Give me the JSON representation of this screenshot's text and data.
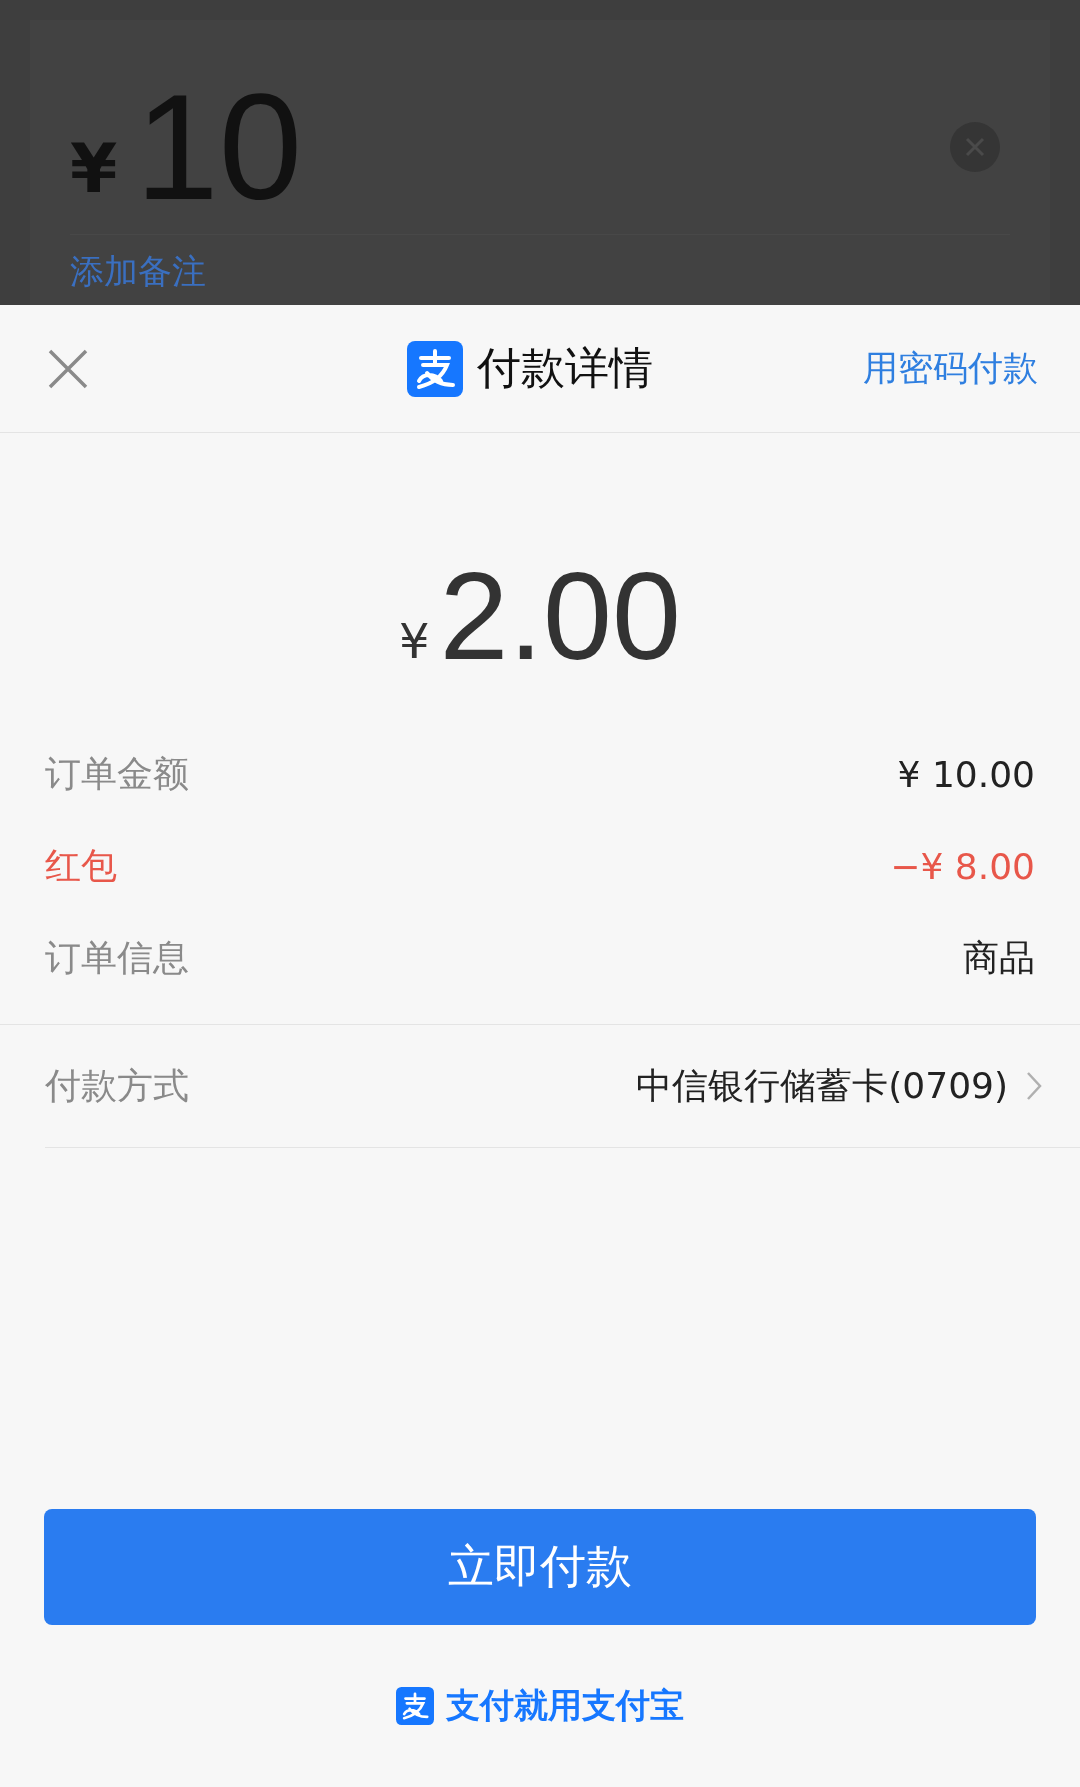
{
  "background_page": {
    "currency": "¥",
    "amount": "10",
    "note_link": "添加备注"
  },
  "sheet": {
    "title": "付款详情",
    "password_link": "用密码付款",
    "amount": {
      "currency": "¥",
      "value": "2.00"
    },
    "details": [
      {
        "label": "订单金额",
        "value": "¥ 10.00",
        "kind": "normal"
      },
      {
        "label": "红包",
        "value": "−¥ 8.00",
        "kind": "discount"
      },
      {
        "label": "订单信息",
        "value": "商品",
        "kind": "normal"
      }
    ],
    "payment_method": {
      "label": "付款方式",
      "value": "中信银行储蓄卡(0709)"
    },
    "pay_button": "立即付款",
    "slogan": "支付就用支付宝"
  }
}
